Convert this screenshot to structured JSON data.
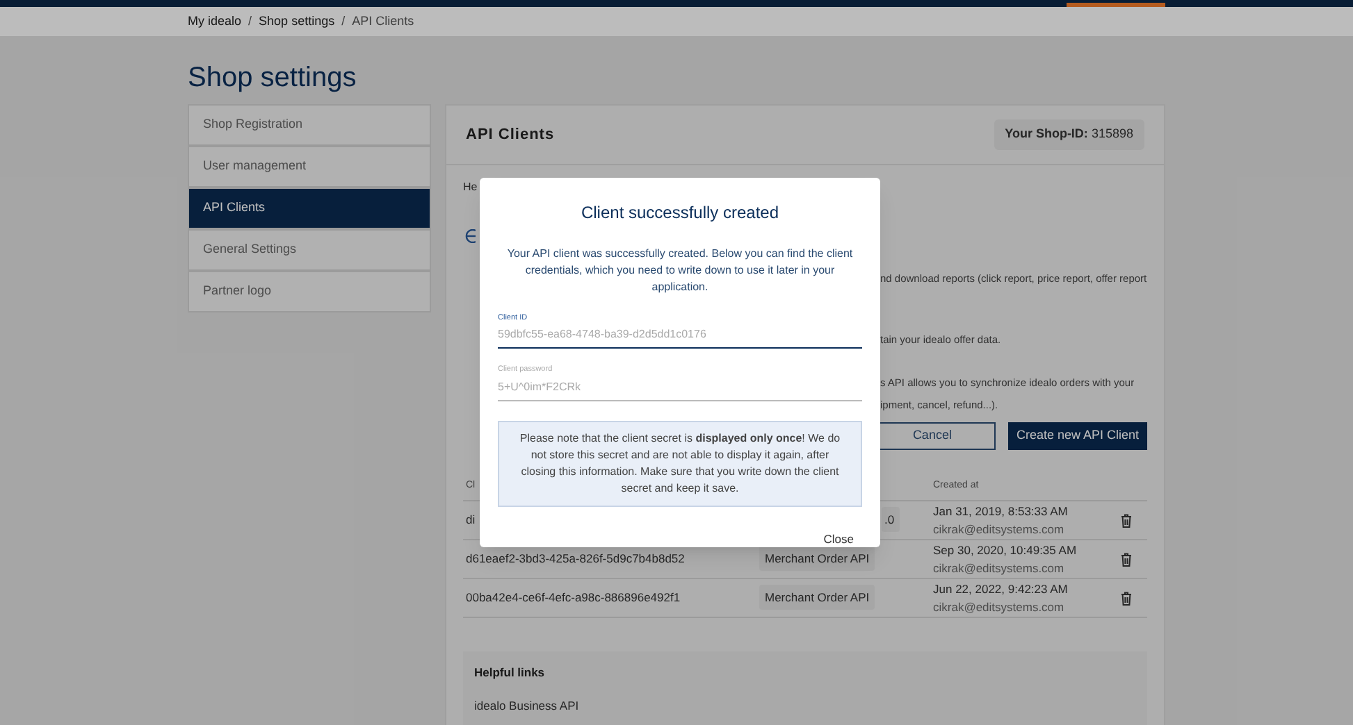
{
  "breadcrumb": [
    "My idealo",
    "Shop settings",
    "API Clients"
  ],
  "breadcrumb_separator": "/",
  "page_title": "Shop settings",
  "sidebar": {
    "items": [
      {
        "label": "Shop Registration",
        "selected": false
      },
      {
        "label": "User management",
        "selected": false
      },
      {
        "label": "API Clients",
        "selected": true
      },
      {
        "label": "General Settings",
        "selected": false
      },
      {
        "label": "Partner logo",
        "selected": false
      }
    ]
  },
  "panel": {
    "title": "API Clients",
    "shop_id_label": "Your Shop-ID:",
    "shop_id": "315898",
    "intro_fragment": "He",
    "description_fragments": [
      "nd download reports (click report, price report, offer report",
      "tain your idealo offer data.",
      "s API allows you to synchronize idealo orders with your",
      "ipment, cancel, refund...)."
    ],
    "buttons": [
      {
        "label": "Cancel",
        "kind": "outline"
      },
      {
        "label": "Create new API Client",
        "kind": "primary"
      }
    ],
    "table": {
      "columns": [
        "Cl",
        "Created at"
      ],
      "rows": [
        {
          "client_id": "di",
          "type": ".0",
          "created": "Jan 31, 2019, 8:53:33 AM",
          "user": "cikrak@editsystems.com"
        },
        {
          "client_id": "d61eaef2-3bd3-425a-826f-5d9c7b4b8d52",
          "type": "Merchant Order API",
          "created": "Sep 30, 2020, 10:49:35 AM",
          "user": "cikrak@editsystems.com"
        },
        {
          "client_id": "00ba42e4-ce6f-4efc-a98c-886896e492f1",
          "type": "Merchant Order API",
          "created": "Jun 22, 2022, 9:42:23 AM",
          "user": "cikrak@editsystems.com"
        }
      ]
    },
    "helpful_links": {
      "title": "Helpful links",
      "links": [
        "idealo Business API"
      ]
    }
  },
  "modal": {
    "title": "Client successfully created",
    "message": "Your API client was successfully created. Below you can find the client credentials, which you need to write down to use it later in your application.",
    "fields": [
      {
        "label": "Client ID",
        "value": "59dbfc55-ea68-4748-ba39-d2d5dd1c0176",
        "focused": true
      },
      {
        "label": "Client password",
        "value": "5+U^0im*F2CRk",
        "focused": false
      }
    ],
    "note": "Please note that the client secret is **displayed only once**! We do not store this secret and are not able to display it again, after closing this information. Make sure that you write down the client secret and keep it save.",
    "close_button": "Close"
  }
}
